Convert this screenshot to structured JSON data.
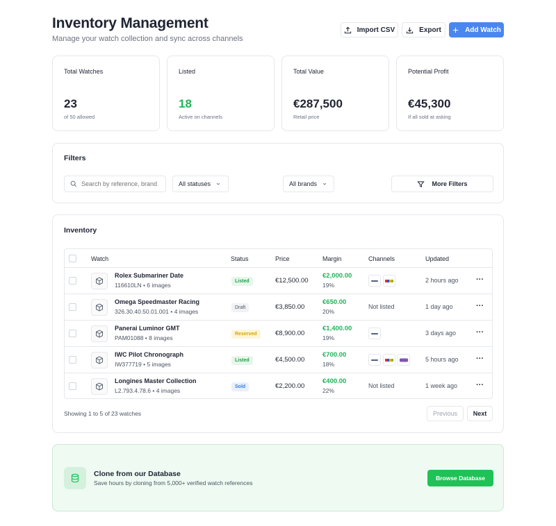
{
  "header": {
    "title": "Inventory Management",
    "subtitle": "Manage your watch collection and sync across channels",
    "import_label": "Import CSV",
    "export_label": "Export",
    "add_label": "Add Watch"
  },
  "stats": [
    {
      "label": "Total Watches",
      "value": "23",
      "sub": "of 50 allowed"
    },
    {
      "label": "Listed",
      "value": "18",
      "sub": "Active on channels",
      "value_color": "#22b35a"
    },
    {
      "label": "Total Value",
      "value": "€287,500",
      "sub": "Retail price"
    },
    {
      "label": "Potential Profit",
      "value": "€45,300",
      "sub": "If all sold at asking"
    }
  ],
  "filters": {
    "title": "Filters",
    "search_placeholder": "Search by reference, brand",
    "status_select": "All statuses",
    "brand_select": "All brands",
    "more_filters": "More Filters"
  },
  "inventory": {
    "title": "Inventory",
    "columns": [
      "Watch",
      "Status",
      "Price",
      "Margin",
      "Channels",
      "Updated"
    ],
    "rows": [
      {
        "name": "Rolex Submariner Date",
        "sub": "116610LN • 6 images",
        "status": "Listed",
        "price": "€12,500.00",
        "margin": "€2,000.00",
        "margin_pct": "19%",
        "channels": [
          "chrono24",
          "ebay"
        ],
        "channels_text": "",
        "updated": "2 hours ago"
      },
      {
        "name": "Omega Speedmaster Racing",
        "sub": "326.30.40.50.01.001 • 4 images",
        "status": "Draft",
        "price": "€3,850.00",
        "margin": "€650.00",
        "margin_pct": "20%",
        "channels": [],
        "channels_text": "Not listed",
        "updated": "1 day ago"
      },
      {
        "name": "Panerai Luminor GMT",
        "sub": "PAM01088 • 8 images",
        "status": "Reserved",
        "price": "€8,900.00",
        "margin": "€1,400.00",
        "margin_pct": "19%",
        "channels": [
          "chrono24"
        ],
        "channels_text": "",
        "updated": "3 days ago"
      },
      {
        "name": "IWC Pilot Chronograph",
        "sub": "IW377719 • 5 images",
        "status": "Listed",
        "price": "€4,500.00",
        "margin": "€700.00",
        "margin_pct": "18%",
        "channels": [
          "chrono24",
          "ebay",
          "woo"
        ],
        "channels_text": "",
        "updated": "5 hours ago"
      },
      {
        "name": "Longines Master Collection",
        "sub": "L2.793.4.78.6 • 4 images",
        "status": "Sold",
        "price": "€2,200.00",
        "margin": "€400.00",
        "margin_pct": "22%",
        "channels": [],
        "channels_text": "Not listed",
        "updated": "1 week ago"
      }
    ],
    "showing": "Showing 1 to 5 of 23 watches",
    "previous": "Previous",
    "next": "Next"
  },
  "clone": {
    "title": "Clone from our Database",
    "subtitle": "Save hours by cloning from 5,000+ verified watch references",
    "button": "Browse Database"
  },
  "colors": {
    "primary": "#4a86f0",
    "green": "#22b35a",
    "browse": "#1ec256"
  }
}
